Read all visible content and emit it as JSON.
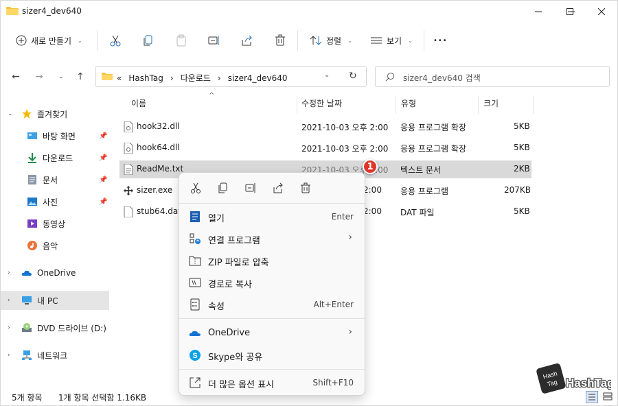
{
  "window": {
    "title": "sizer4_dev640"
  },
  "toolbar": {
    "new_label": "새로 만들기",
    "sort_label": "정렬",
    "view_label": "보기",
    "more_label": "•••"
  },
  "address": {
    "overflow": "«",
    "crumbs": [
      "HashTag",
      "다운로드",
      "sizer4_dev640"
    ],
    "sep": "›"
  },
  "search": {
    "placeholder": "sizer4_dev640 검색"
  },
  "sidebar": {
    "quick_access": "즐겨찾기",
    "items": [
      {
        "label": "바탕 화면"
      },
      {
        "label": "다운로드"
      },
      {
        "label": "문서"
      },
      {
        "label": "사진"
      },
      {
        "label": "동영상"
      },
      {
        "label": "음악"
      }
    ],
    "onedrive": "OneDrive",
    "this_pc": "내 PC",
    "dvd": "DVD 드라이브 (D:)",
    "network": "네트워크"
  },
  "columns": {
    "name": "이름",
    "modified": "수정한 날짜",
    "type": "유형",
    "size": "크기"
  },
  "files": [
    {
      "name": "hook32.dll",
      "modified": "2021-10-03 오후 2:00",
      "type": "응용 프로그램 확장",
      "size": "5KB"
    },
    {
      "name": "hook64.dll",
      "modified": "2021-10-03 오후 2:00",
      "type": "응용 프로그램 확장",
      "size": "5KB"
    },
    {
      "name": "ReadMe.txt",
      "modified": "2021-10-03 오후 2:00",
      "type": "텍스트 문서",
      "size": "2KB"
    },
    {
      "name": "sizer.exe",
      "modified": "2:00",
      "type": "응용 프로그램",
      "size": "207KB"
    },
    {
      "name": "stub64.dat",
      "modified": "2:00",
      "type": "DAT 파일",
      "size": "5KB"
    }
  ],
  "status": {
    "count": "5개 항목",
    "selection": "1개 항목 선택함 1.16KB"
  },
  "context_menu": {
    "open": {
      "label": "열기",
      "shortcut": "Enter"
    },
    "open_with": {
      "label": "연결 프로그램"
    },
    "zip": {
      "label": "ZIP 파일로 압축"
    },
    "copy_path": {
      "label": "경로로 복사"
    },
    "properties": {
      "label": "속성",
      "shortcut": "Alt+Enter"
    },
    "onedrive": {
      "label": "OneDrive"
    },
    "skype": {
      "label": "Skype와 공유"
    },
    "more": {
      "label": "더 많은 옵션 표시",
      "shortcut": "Shift+F10"
    }
  },
  "badge": {
    "number": "1"
  },
  "watermark": {
    "text": "HashTag"
  },
  "colors": {
    "accent": "#0a67c2",
    "selection": "#d9d9d9",
    "badge": "#e0352b",
    "folder": "#f6c443"
  }
}
